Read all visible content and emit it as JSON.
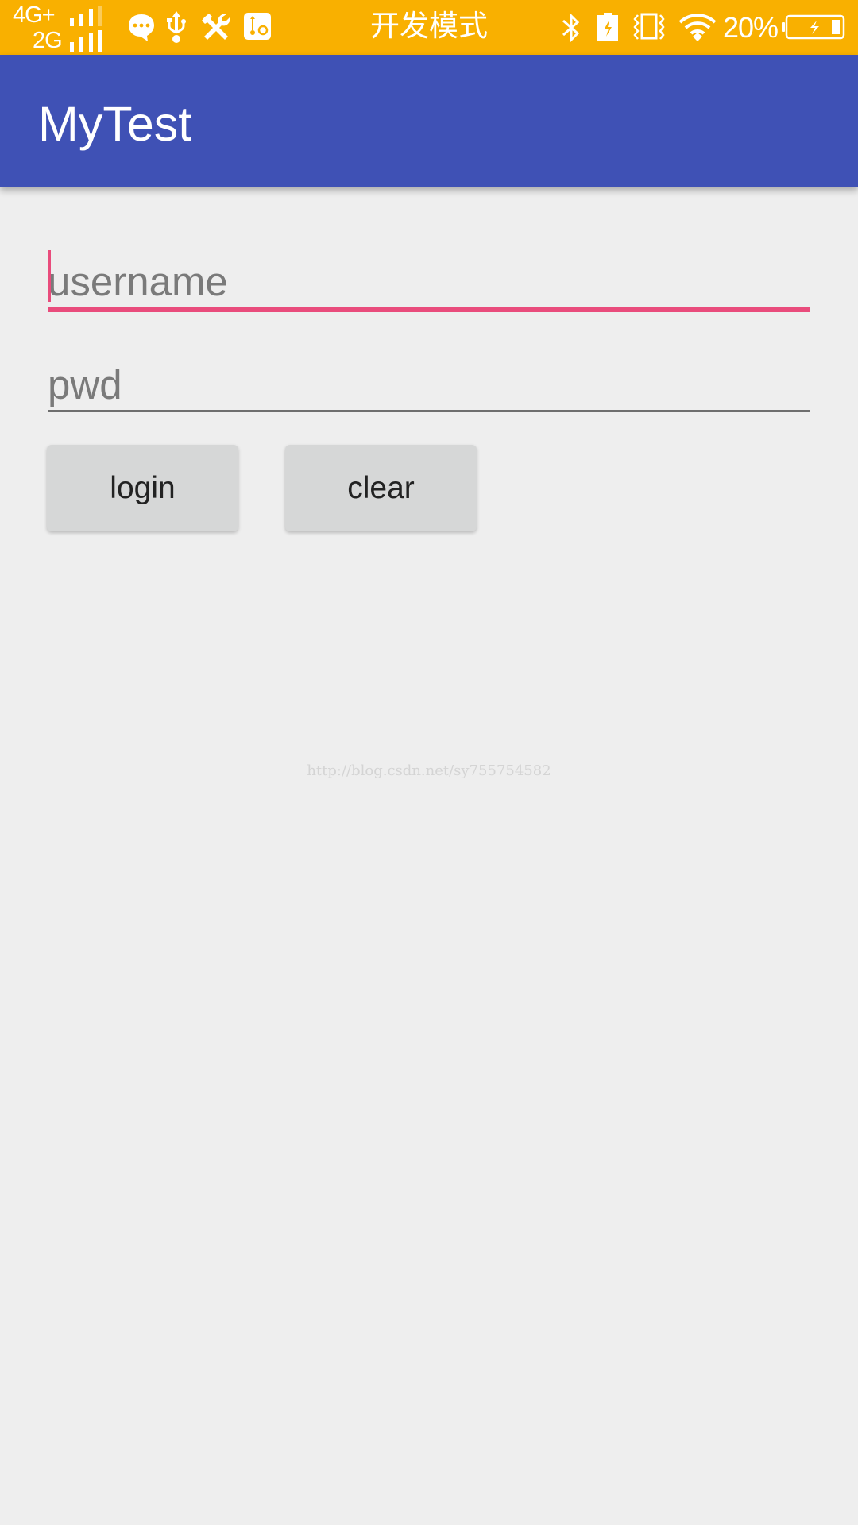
{
  "status_bar": {
    "network_primary": "4G+",
    "network_secondary": "2G",
    "notification_icons": [
      "message-icon",
      "usb-icon",
      "developer-tools-icon",
      "usb-settings-icon"
    ],
    "center_text": "开发模式",
    "system_icons": [
      "bluetooth-icon",
      "battery-saver-charging-icon",
      "vibrate-icon",
      "wifi-icon"
    ],
    "battery_percent_label": "20%",
    "battery_level": 0.2,
    "battery_charging": true
  },
  "app_bar": {
    "title": "MyTest"
  },
  "form": {
    "username": {
      "value": "",
      "placeholder": "username",
      "focused": true
    },
    "password": {
      "value": "",
      "placeholder": "pwd",
      "focused": false
    },
    "login_label": "login",
    "clear_label": "clear"
  },
  "watermark": "http://blog.csdn.net/sy755754582",
  "colors": {
    "status_bar": "#F9B000",
    "primary": "#3F51B5",
    "accent": "#E94C7C",
    "background": "#EEEEEE",
    "button": "#D6D7D7"
  }
}
